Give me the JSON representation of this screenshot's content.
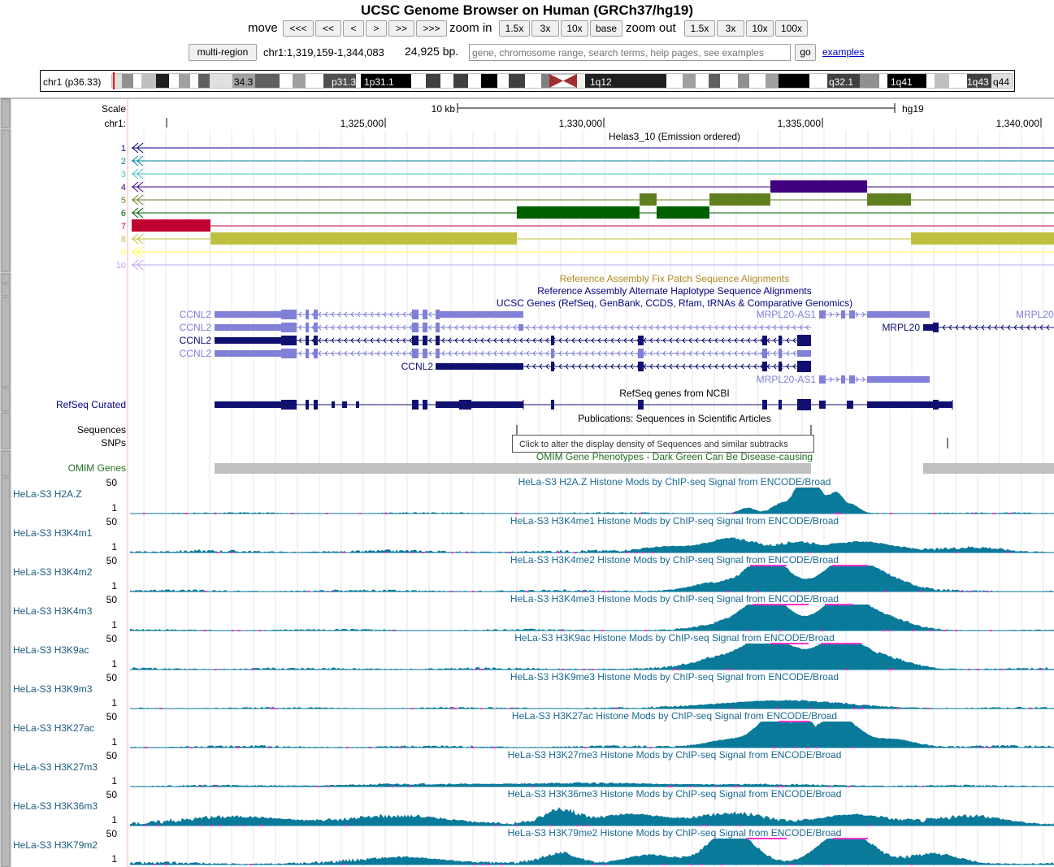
{
  "title": "UCSC Genome Browser on Human (GRCh37/hg19)",
  "nav": {
    "move_label": "move",
    "move_buttons": [
      "<<<",
      "<<",
      "<",
      ">",
      ">>",
      ">>>"
    ],
    "zoom_in_label": "zoom in",
    "zoom_in_buttons": [
      "1.5x",
      "3x",
      "10x",
      "base"
    ],
    "zoom_out_label": "zoom out",
    "zoom_out_buttons": [
      "1.5x",
      "3x",
      "10x",
      "100x"
    ],
    "multi_region": "multi-region",
    "position": "chr1:1,319,159-1,344,083",
    "size": "24,925 bp.",
    "search_placeholder": "gene, chromosome range, search terms, help pages, see examples",
    "go": "go",
    "examples": "examples"
  },
  "ideogram": {
    "label": "chr1 (p36.33)",
    "bands": [
      "34.3",
      "33",
      "p31.3",
      "1p31.1",
      "1q12",
      "q32.1",
      "1q41",
      "1q43",
      "q44"
    ]
  },
  "ruler": {
    "scale_label": "Scale",
    "chrom_label": "chr1:",
    "scale_text": "10 kb",
    "assembly": "hg19",
    "positions": [
      "1,325,000",
      "1,330,000",
      "1,335,000",
      "1,340,000"
    ]
  },
  "chromhmm": {
    "title": "Helas3_10 (Emission ordered)",
    "states": [
      "1",
      "2",
      "3",
      "4",
      "5",
      "6",
      "7",
      "8",
      "9",
      "10"
    ],
    "colors": [
      "#000080",
      "#0080a0",
      "#40c0c0",
      "#400080",
      "#608020",
      "#006000",
      "#c00030",
      "#c0c040",
      "#ffff40",
      "#c0a0ff"
    ]
  },
  "tracks": {
    "fix_patch": "Reference Assembly Fix Patch Sequence Alignments",
    "alt_haplo": "Reference Assembly Alternate Haplotype Sequence Alignments",
    "ucsc_genes": "UCSC Genes (RefSeq, GenBank, CCDS, Rfam, tRNAs & Comparative Genomics)",
    "refseq_title": "RefSeq genes from NCBI",
    "refseq_label": "RefSeq Curated",
    "publications": "Publications: Sequences in Scientific Articles",
    "sequences_label": "Sequences",
    "snps_label": "SNPs",
    "omim_label": "OMIM Genes",
    "omim_title": "OMIM Gene Phenotypes - Dark Green Can Be Disease-causing",
    "tooltip": "Click to alter the display density of Sequences and similar subtracks"
  },
  "genes": {
    "ccnl2": "CCNL2",
    "mrpl20_as1": "MRPL20-AS1",
    "mrpl20": "MRPL20",
    "mrpl2_trunc": "MRPL20"
  },
  "histone": {
    "max": "50",
    "min": "1",
    "tracks": [
      {
        "label": "HeLa-S3 H2A.Z",
        "title": "HeLa-S3 H2A.Z Histone Mods by ChIP-seq Signal from ENCODE/Broad"
      },
      {
        "label": "HeLa-S3 H3K4m1",
        "title": "HeLa-S3 H3K4me1 Histone Mods by ChIP-seq Signal from ENCODE/Broad"
      },
      {
        "label": "HeLa-S3 H3K4m2",
        "title": "HeLa-S3 H3K4me2 Histone Mods by ChIP-seq Signal from ENCODE/Broad"
      },
      {
        "label": "HeLa-S3 H3K4m3",
        "title": "HeLa-S3 H3K4me3 Histone Mods by ChIP-seq Signal from ENCODE/Broad"
      },
      {
        "label": "HeLa-S3 H3K9ac",
        "title": "HeLa-S3 H3K9ac Histone Mods by ChIP-seq Signal from ENCODE/Broad"
      },
      {
        "label": "HeLa-S3 H3K9m3",
        "title": "HeLa-S3 H3K9me3 Histone Mods by ChIP-seq Signal from ENCODE/Broad"
      },
      {
        "label": "HeLa-S3 H3K27ac",
        "title": "HeLa-S3 H3K27ac Histone Mods by ChIP-seq Signal from ENCODE/Broad"
      },
      {
        "label": "HeLa-S3 H3K27m3",
        "title": "HeLa-S3 H3K27me3 Histone Mods by ChIP-seq Signal from ENCODE/Broad"
      },
      {
        "label": "HeLa-S3 H3K36m3",
        "title": "HeLa-S3 H3K36me3 Histone Mods by ChIP-seq Signal from ENCODE/Broad"
      },
      {
        "label": "HeLa-S3 H3K79m2",
        "title": "HeLa-S3 H3K79me2 Histone Mods by ChIP-seq Signal from ENCODE/Broad"
      }
    ],
    "signal_color": "#0a7a9a",
    "overflow_color": "#ff33cc"
  }
}
